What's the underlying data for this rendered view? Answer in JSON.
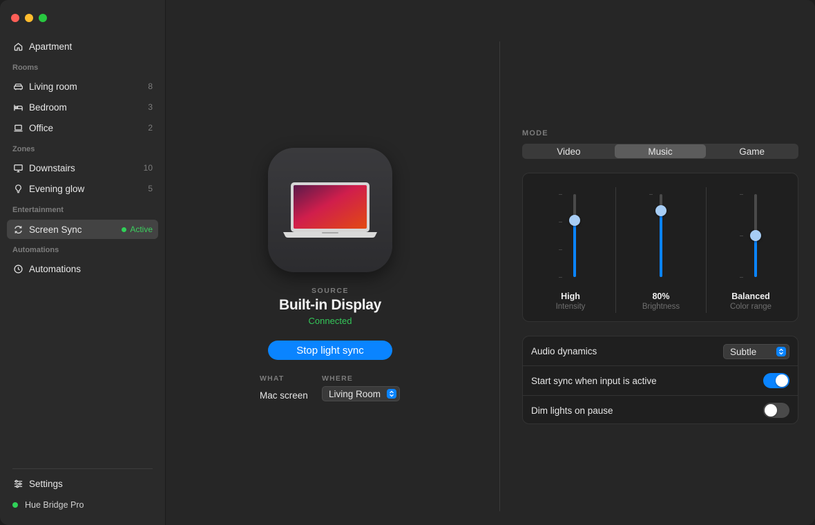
{
  "sidebar": {
    "home": {
      "label": "Apartment",
      "icon": "house-icon"
    },
    "sections": {
      "rooms": "Rooms",
      "zones": "Zones",
      "entertainment": "Entertainment",
      "automations": "Automations"
    },
    "rooms": [
      {
        "label": "Living room",
        "count": "8",
        "icon": "sofa-icon"
      },
      {
        "label": "Bedroom",
        "count": "3",
        "icon": "bed-icon"
      },
      {
        "label": "Office",
        "count": "2",
        "icon": "laptop-icon"
      }
    ],
    "zones": [
      {
        "label": "Downstairs",
        "count": "10",
        "icon": "monitor-icon"
      },
      {
        "label": "Evening glow",
        "count": "5",
        "icon": "lightbulb-icon"
      }
    ],
    "entertainment": {
      "label": "Screen Sync",
      "badge": "Active",
      "icon": "sync-icon"
    },
    "automations": {
      "label": "Automations",
      "icon": "clock-icon"
    },
    "settings": {
      "label": "Settings",
      "icon": "sliders-icon"
    },
    "bridge": {
      "label": "Hue Bridge Pro",
      "status_color": "#30d158"
    }
  },
  "source": {
    "label": "SOURCE",
    "title": "Built-in Display",
    "status": "Connected",
    "action": "Stop light sync",
    "what_label": "WHAT",
    "what_value": "Mac screen",
    "where_label": "WHERE",
    "where_value": "Living Room"
  },
  "mode": {
    "label": "MODE",
    "options": [
      "Video",
      "Music",
      "Game"
    ],
    "selected": "Music"
  },
  "sliders": [
    {
      "value": "High",
      "label": "Intensity",
      "level": 0.68
    },
    {
      "value": "80%",
      "label": "Brightness",
      "level": 0.8
    },
    {
      "value": "Balanced",
      "label": "Color range",
      "level": 0.5
    }
  ],
  "settings": {
    "audio_dynamics": {
      "label": "Audio dynamics",
      "value": "Subtle"
    },
    "start_sync": {
      "label": "Start sync when input is active",
      "on": true
    },
    "dim_lights": {
      "label": "Dim lights on pause",
      "on": false
    }
  },
  "colors": {
    "accent": "#0a84ff",
    "success": "#34c759"
  }
}
